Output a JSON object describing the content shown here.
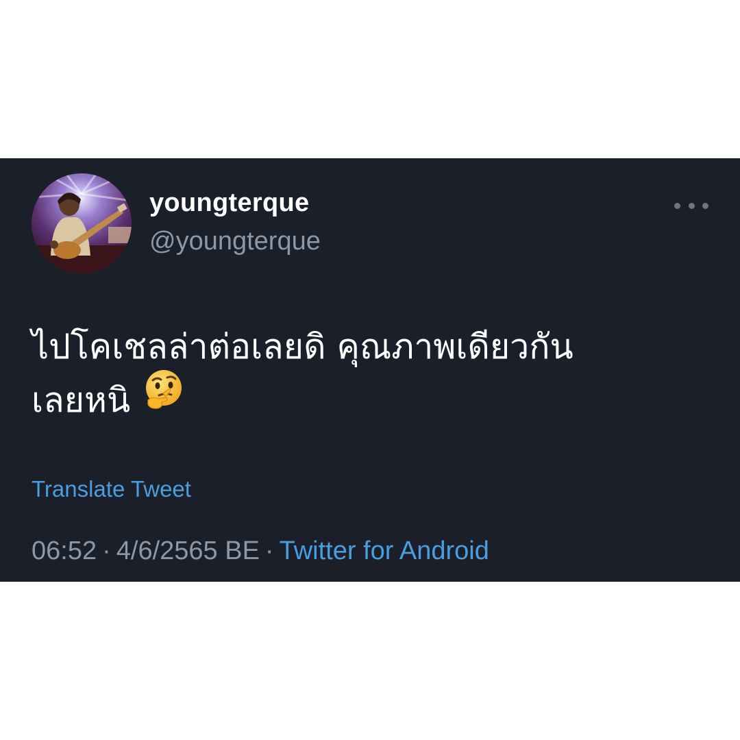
{
  "tweet": {
    "display_name": "youngterque",
    "handle": "@youngterque",
    "avatar_icon": "guitarist-avatar-icon",
    "more_icon": "more-horizontal-icon",
    "text_line1": "ไปโคเชลล่าต่อเลยดิ คุณภาพเดียวกัน",
    "text_line2": "เลยหนิ",
    "emoji_icon": "thinking-face-icon",
    "translate_label": "Translate Tweet",
    "time": "06:52",
    "separator": "·",
    "date": "4/6/2565 BE",
    "source": "Twitter for Android"
  },
  "colors": {
    "card_background": "#1a1f29",
    "page_background": "#ffffff",
    "primary_text": "#ffffff",
    "secondary_text": "#8b98a5",
    "link": "#4a9ee0"
  }
}
